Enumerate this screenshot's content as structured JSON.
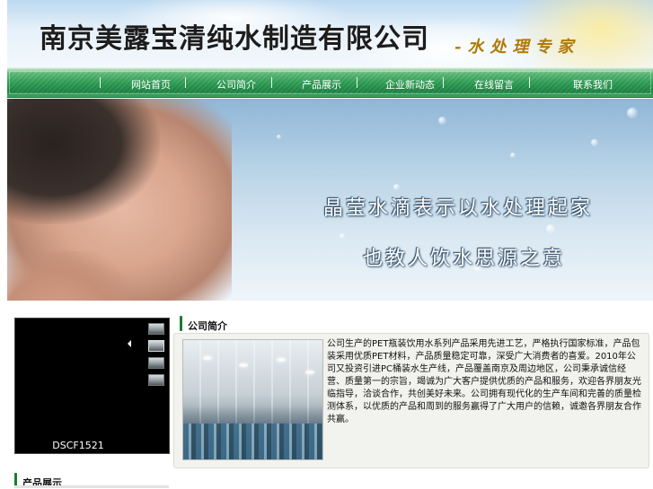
{
  "header": {
    "company_name": "南京美露宝清纯水制造有限公司",
    "slogan": "-水处理专家"
  },
  "nav": {
    "items": [
      {
        "label": "网站首页"
      },
      {
        "label": "公司简介"
      },
      {
        "label": "产品展示"
      },
      {
        "label": "企业新动态"
      },
      {
        "label": "在线留言"
      },
      {
        "label": "联系我们"
      }
    ]
  },
  "hero": {
    "line1": "晶莹水滴表示以水处理起家",
    "line2": "也教人饮水思源之意"
  },
  "slideshow": {
    "caption": "DSCF1521",
    "thumb_count": 4,
    "active_index": 1
  },
  "about": {
    "heading": "公司简介",
    "text": "公司生产的PET瓶装饮用水系列产品采用先进工艺，严格执行国家标准，产品包装采用优质PET材料，产品质量稳定可靠，深受广大消费者的喜爱。2010年公司又投资引进PC桶装水生产线，产品覆盖南京及周边地区，公司秉承诚信经营、质量第一的宗旨，竭诚为广大客户提供优质的产品和服务，欢迎各界朋友光临指导，洽谈合作，共创美好未来。公司拥有现代化的生产车间和完善的质量检测体系，以优质的产品和周到的服务赢得了广大用户的信赖，诚邀各界朋友合作共赢。"
  },
  "products": {
    "heading": "产品展示"
  },
  "colors": {
    "nav_green": "#2e9e55",
    "marker_green": "#1c7a33",
    "slogan_gold": "#b07a05"
  }
}
